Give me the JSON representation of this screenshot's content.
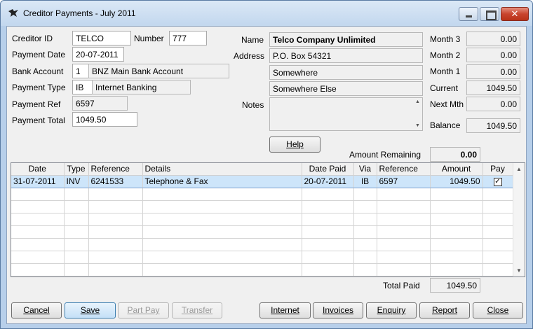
{
  "window": {
    "title": "Creditor Payments - July 2011"
  },
  "form": {
    "creditor_id_label": "Creditor ID",
    "creditor_id": "TELCO",
    "number_label": "Number",
    "number": "777",
    "payment_date_label": "Payment Date",
    "payment_date": "20-07-2011",
    "bank_account_label": "Bank Account",
    "bank_account_code": "1",
    "bank_account_name": "BNZ Main Bank Account",
    "payment_type_label": "Payment Type",
    "payment_type_code": "IB",
    "payment_type_name": "Internet Banking",
    "payment_ref_label": "Payment Ref",
    "payment_ref": "6597",
    "payment_total_label": "Payment Total",
    "payment_total": "1049.50"
  },
  "creditor": {
    "name_label": "Name",
    "name": "Telco Company Unlimited",
    "address_label": "Address",
    "address1": "P.O. Box 54321",
    "address2": "Somewhere",
    "address3": "Somewhere Else",
    "notes_label": "Notes",
    "notes": ""
  },
  "aging": {
    "month3_label": "Month 3",
    "month3": "0.00",
    "month2_label": "Month 2",
    "month2": "0.00",
    "month1_label": "Month 1",
    "month1": "0.00",
    "current_label": "Current",
    "current": "1049.50",
    "next_mth_label": "Next Mth",
    "next_mth": "0.00",
    "balance_label": "Balance",
    "balance": "1049.50"
  },
  "help_button": "Help",
  "amount_remaining_label": "Amount Remaining",
  "amount_remaining": "0.00",
  "grid": {
    "columns": [
      "Date",
      "Type",
      "Reference",
      "Details",
      "Date Paid",
      "Via",
      "Reference",
      "Amount",
      "Pay"
    ],
    "rows": [
      {
        "date": "31-07-2011",
        "type": "INV",
        "reference": "6241533",
        "details": "Telephone & Fax",
        "date_paid": "20-07-2011",
        "via": "IB",
        "pay_reference": "6597",
        "amount": "1049.50",
        "pay": true
      }
    ]
  },
  "total_paid_label": "Total Paid",
  "total_paid": "1049.50",
  "buttons": {
    "cancel": "Cancel",
    "save": "Save",
    "part_pay": "Part Pay",
    "transfer": "Transfer",
    "internet": "Internet",
    "invoices": "Invoices",
    "enquiry": "Enquiry",
    "report": "Report",
    "close": "Close"
  }
}
